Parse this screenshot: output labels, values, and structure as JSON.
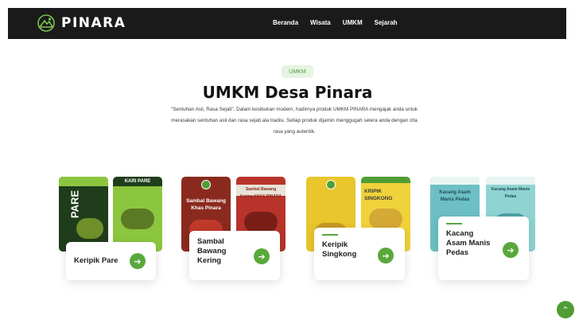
{
  "brand": {
    "name": "PINARA",
    "icon": "mountain-logo-icon"
  },
  "nav": [
    {
      "label": "Beranda"
    },
    {
      "label": "Wisata"
    },
    {
      "label": "UMKM"
    },
    {
      "label": "Sejarah"
    }
  ],
  "section": {
    "badge": "UMKM",
    "title": "UMKM Desa Pinara",
    "description": "\"Sentuhan Asli, Rasa Sejati\". Dalam kesibukan modern, hadirnya produk UMKM PINARA mengajak anda untuk merasakan sentuhan asli dan rasa sejati ala tradisi. Setiap produk dijamin menggugah selera anda dengan cita rasa yang autentik."
  },
  "products": [
    {
      "name": "Keripik Pare",
      "pack_left_text": "PARE",
      "pack_right_text": "KARI PARE",
      "colors": [
        "#1f3d1b",
        "#8cc63f"
      ]
    },
    {
      "name": "Sambal Bawang Kering",
      "pack_left_text": "Sambal Bawang Khas Pinara",
      "pack_right_text": "Sambal Bawang Kering KHAS PINARA",
      "colors": [
        "#8a2a1e",
        "#b8342b"
      ]
    },
    {
      "name": "Keripik Singkong",
      "pack_left_text": "",
      "pack_right_text": "KRIPIK SINGKONG",
      "colors": [
        "#e9c62c",
        "#f0d23a"
      ]
    },
    {
      "name": "Kacang Asam Manis Pedas",
      "pack_left_text": "Kacang Asam Manis Pedas",
      "pack_right_text": "Kacang Asam Manis Pedas",
      "colors": [
        "#6cc0c5",
        "#8fd4d3"
      ]
    }
  ],
  "colors": {
    "accent": "#5aa83c",
    "topbar": "#1a1a1a"
  },
  "scroll_top_icon": "chevron-up-icon"
}
